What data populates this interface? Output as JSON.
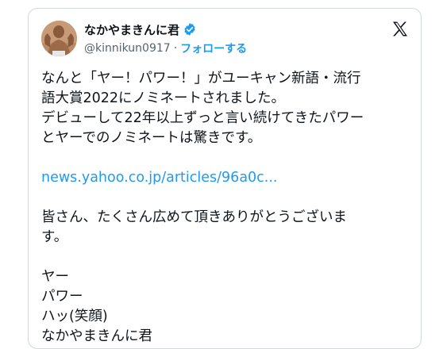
{
  "tweet": {
    "display_name": "なかやまきんに君",
    "handle": "@kinnikun0917",
    "separator": "·",
    "follow_label": "フォローする",
    "verified_icon": "verified-badge-icon",
    "brand_icon": "x-logo-icon",
    "accent_color": "#1d9bf0",
    "paragraph1_lines": [
      "なんと「ヤー！パワー！」がユーキャン新語・流行",
      "語大賞2022にノミネートされました。",
      "デビューして22年以上ずっと言い続けてきたパワー",
      "とヤーでのノミネートは驚きです。"
    ],
    "link_text": "news.yahoo.co.jp/articles/96a0c...",
    "paragraph2_lines": [
      "皆さん、たくさん広めて頂きありがとうございま",
      "す。"
    ],
    "paragraph3_lines": [
      "ヤー",
      "パワー",
      "ハッ(笑顔)",
      "なかやまきんに君"
    ]
  }
}
